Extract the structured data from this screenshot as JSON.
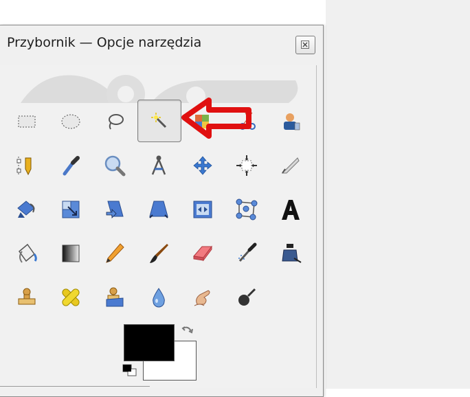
{
  "window": {
    "title": "Przybornik — Opcje narzędzia",
    "close_icon": "close-icon"
  },
  "tools": [
    {
      "name": "rect-select-tool",
      "icon": "rect-select-icon"
    },
    {
      "name": "ellipse-select-tool",
      "icon": "ellipse-select-icon"
    },
    {
      "name": "free-select-tool",
      "icon": "lasso-icon"
    },
    {
      "name": "fuzzy-select-tool",
      "icon": "magic-wand-icon",
      "active": true
    },
    {
      "name": "select-by-color-tool",
      "icon": "select-by-color-icon"
    },
    {
      "name": "scissors-select-tool",
      "icon": "scissors-icon"
    },
    {
      "name": "foreground-select-tool",
      "icon": "foreground-select-icon"
    },
    {
      "name": "paths-tool",
      "icon": "paths-pen-icon"
    },
    {
      "name": "color-picker-tool",
      "icon": "eyedropper-icon"
    },
    {
      "name": "zoom-tool",
      "icon": "magnifier-icon"
    },
    {
      "name": "measure-tool",
      "icon": "compass-icon"
    },
    {
      "name": "move-tool",
      "icon": "move-arrows-icon"
    },
    {
      "name": "align-tool",
      "icon": "align-icon"
    },
    {
      "name": "crop-tool",
      "icon": "knife-icon"
    },
    {
      "name": "rotate-tool",
      "icon": "rotate-icon"
    },
    {
      "name": "scale-tool",
      "icon": "scale-icon"
    },
    {
      "name": "shear-tool",
      "icon": "shear-icon"
    },
    {
      "name": "perspective-tool",
      "icon": "perspective-icon"
    },
    {
      "name": "flip-tool",
      "icon": "flip-icon"
    },
    {
      "name": "cage-tool",
      "icon": "cage-transform-icon"
    },
    {
      "name": "text-tool",
      "icon": "text-a-icon"
    },
    {
      "name": "bucket-fill-tool",
      "icon": "bucket-fill-icon"
    },
    {
      "name": "blend-tool",
      "icon": "gradient-icon"
    },
    {
      "name": "pencil-tool",
      "icon": "pencil-icon"
    },
    {
      "name": "paintbrush-tool",
      "icon": "paintbrush-icon"
    },
    {
      "name": "eraser-tool",
      "icon": "eraser-icon"
    },
    {
      "name": "airbrush-tool",
      "icon": "airbrush-icon"
    },
    {
      "name": "ink-tool",
      "icon": "ink-bottle-icon"
    },
    {
      "name": "clone-tool",
      "icon": "stamp-icon"
    },
    {
      "name": "heal-tool",
      "icon": "bandage-icon"
    },
    {
      "name": "perspective-clone-tool",
      "icon": "perspective-clone-icon"
    },
    {
      "name": "blur-sharpen-tool",
      "icon": "water-drop-icon"
    },
    {
      "name": "smudge-tool",
      "icon": "smudge-finger-icon"
    },
    {
      "name": "dodge-burn-tool",
      "icon": "dodge-burn-icon"
    }
  ],
  "annotation": {
    "arrow_color": "#e01010",
    "arrow_icon": "red-arrow-icon"
  },
  "colors": {
    "foreground": "#000000",
    "background": "#ffffff"
  }
}
